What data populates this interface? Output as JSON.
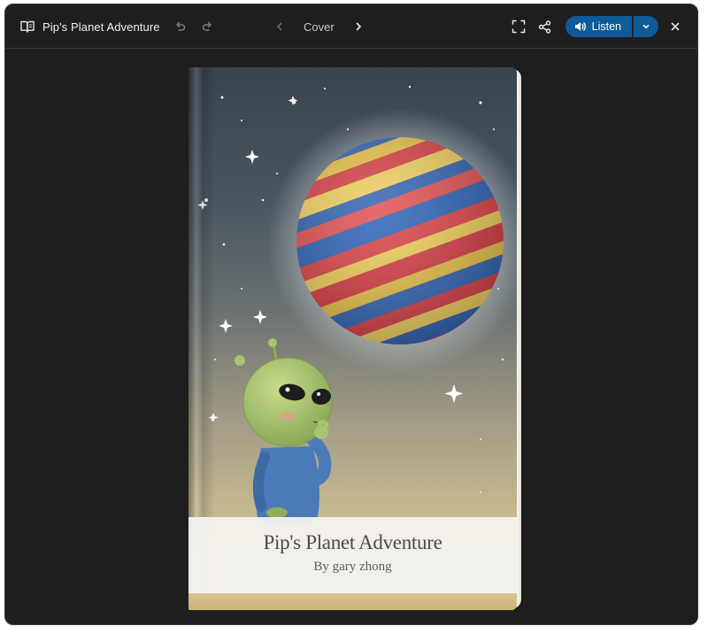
{
  "app": {
    "title": "Pip's Planet Adventure"
  },
  "toolbar": {
    "page_label": "Cover",
    "listen_label": "Listen",
    "icons": {
      "book": "book-open-icon",
      "undo": "undo-icon",
      "redo": "redo-icon",
      "prev": "chevron-left-icon",
      "next": "chevron-right-icon",
      "fullscreen": "fullscreen-icon",
      "share": "share-icon",
      "speaker": "speaker-icon",
      "dropdown": "chevron-down-icon",
      "close": "close-icon"
    }
  },
  "book": {
    "title": "Pip's Planet Adventure",
    "author": "By gary zhong"
  },
  "colors": {
    "window_bg": "#1e1e1e",
    "accent": "#0f5a98",
    "cover_sky_top": "#39434e",
    "cover_sky_bottom": "#d8c794"
  }
}
